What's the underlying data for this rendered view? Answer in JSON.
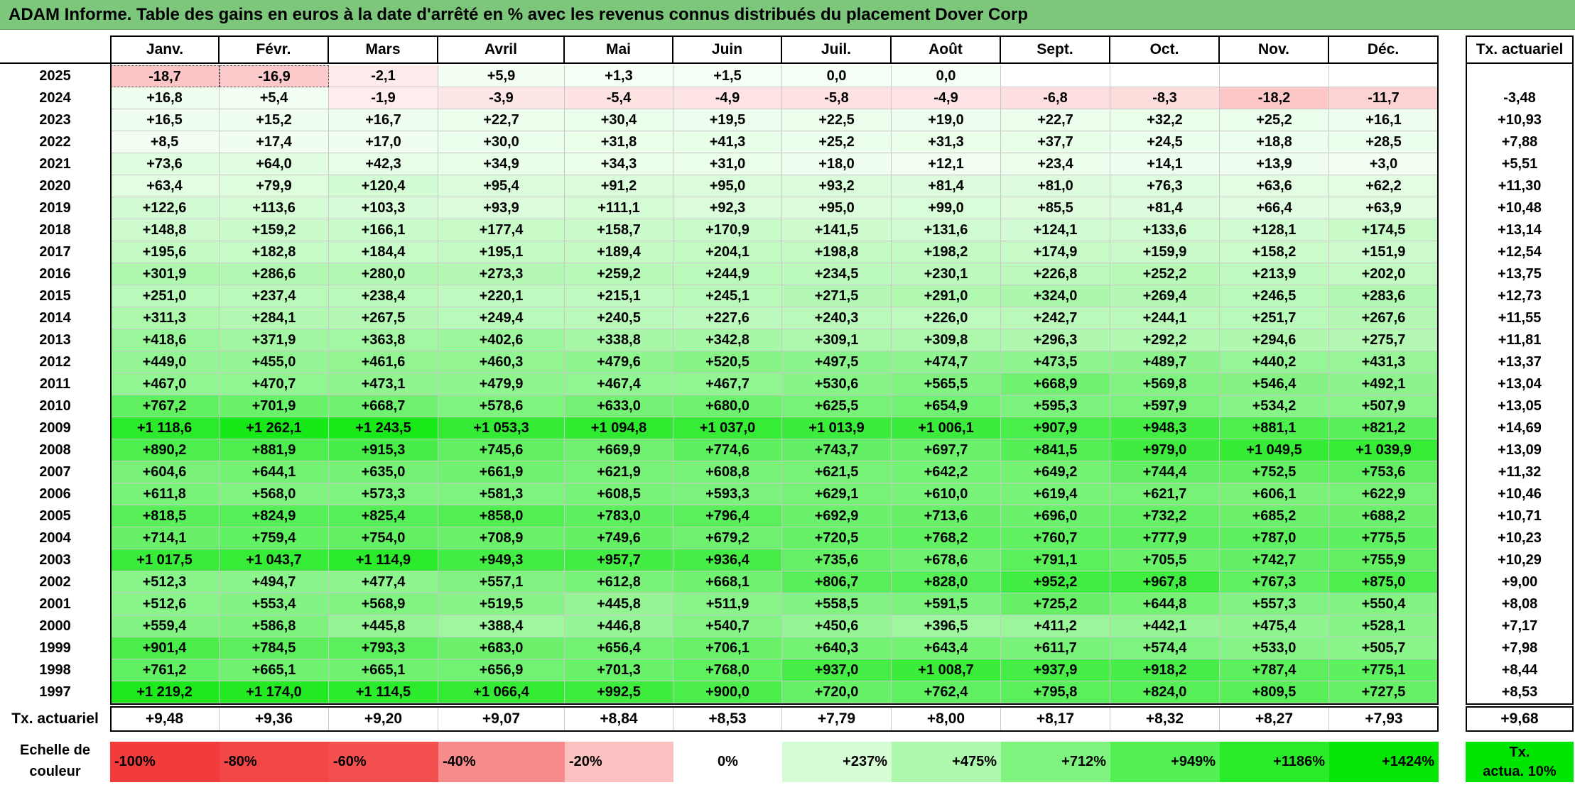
{
  "title": "ADAM Informe. Table des gains en euros à la date d'arrêté en % avec les revenus connus distribués du placement Dover Corp",
  "months": [
    "Janv.",
    "Févr.",
    "Mars",
    "Avril",
    "Mai",
    "Juin",
    "Juil.",
    "Août",
    "Sept.",
    "Oct.",
    "Nov.",
    "Déc."
  ],
  "rate_header": "Tx. actuariel",
  "rows": [
    {
      "year": "2025",
      "values": [
        "-18,7",
        "-16,9",
        "-2,1",
        "+5,9",
        "+1,3",
        "+1,5",
        "0,0",
        "0,0",
        "",
        "",
        "",
        ""
      ],
      "rate": ""
    },
    {
      "year": "2024",
      "values": [
        "+16,8",
        "+5,4",
        "-1,9",
        "-3,9",
        "-5,4",
        "-4,9",
        "-5,8",
        "-4,9",
        "-6,8",
        "-8,3",
        "-18,2",
        "-11,7"
      ],
      "rate": "-3,48"
    },
    {
      "year": "2023",
      "values": [
        "+16,5",
        "+15,2",
        "+16,7",
        "+22,7",
        "+30,4",
        "+19,5",
        "+22,5",
        "+19,0",
        "+22,7",
        "+32,2",
        "+25,2",
        "+16,1"
      ],
      "rate": "+10,93"
    },
    {
      "year": "2022",
      "values": [
        "+8,5",
        "+17,4",
        "+17,0",
        "+30,0",
        "+31,8",
        "+41,3",
        "+25,2",
        "+31,3",
        "+37,7",
        "+24,5",
        "+18,8",
        "+28,5"
      ],
      "rate": "+7,88"
    },
    {
      "year": "2021",
      "values": [
        "+73,6",
        "+64,0",
        "+42,3",
        "+34,9",
        "+34,3",
        "+31,0",
        "+18,0",
        "+12,1",
        "+23,4",
        "+14,1",
        "+13,9",
        "+3,0"
      ],
      "rate": "+5,51"
    },
    {
      "year": "2020",
      "values": [
        "+63,4",
        "+79,9",
        "+120,4",
        "+95,4",
        "+91,2",
        "+95,0",
        "+93,2",
        "+81,4",
        "+81,0",
        "+76,3",
        "+63,6",
        "+62,2"
      ],
      "rate": "+11,30"
    },
    {
      "year": "2019",
      "values": [
        "+122,6",
        "+113,6",
        "+103,3",
        "+93,9",
        "+111,1",
        "+92,3",
        "+95,0",
        "+99,0",
        "+85,5",
        "+81,4",
        "+66,4",
        "+63,9"
      ],
      "rate": "+10,48"
    },
    {
      "year": "2018",
      "values": [
        "+148,8",
        "+159,2",
        "+166,1",
        "+177,4",
        "+158,7",
        "+170,9",
        "+141,5",
        "+131,6",
        "+124,1",
        "+133,6",
        "+128,1",
        "+174,5"
      ],
      "rate": "+13,14"
    },
    {
      "year": "2017",
      "values": [
        "+195,6",
        "+182,8",
        "+184,4",
        "+195,1",
        "+189,4",
        "+204,1",
        "+198,8",
        "+198,2",
        "+174,9",
        "+159,9",
        "+158,2",
        "+151,9"
      ],
      "rate": "+12,54"
    },
    {
      "year": "2016",
      "values": [
        "+301,9",
        "+286,6",
        "+280,0",
        "+273,3",
        "+259,2",
        "+244,9",
        "+234,5",
        "+230,1",
        "+226,8",
        "+252,2",
        "+213,9",
        "+202,0"
      ],
      "rate": "+13,75"
    },
    {
      "year": "2015",
      "values": [
        "+251,0",
        "+237,4",
        "+238,4",
        "+220,1",
        "+215,1",
        "+245,1",
        "+271,5",
        "+291,0",
        "+324,0",
        "+269,4",
        "+246,5",
        "+283,6"
      ],
      "rate": "+12,73"
    },
    {
      "year": "2014",
      "values": [
        "+311,3",
        "+284,1",
        "+267,5",
        "+249,4",
        "+240,5",
        "+227,6",
        "+240,3",
        "+226,0",
        "+242,7",
        "+244,1",
        "+251,7",
        "+267,6"
      ],
      "rate": "+11,55"
    },
    {
      "year": "2013",
      "values": [
        "+418,6",
        "+371,9",
        "+363,8",
        "+402,6",
        "+338,8",
        "+342,8",
        "+309,1",
        "+309,8",
        "+296,3",
        "+292,2",
        "+294,6",
        "+275,7"
      ],
      "rate": "+11,81"
    },
    {
      "year": "2012",
      "values": [
        "+449,0",
        "+455,0",
        "+461,6",
        "+460,3",
        "+479,6",
        "+520,5",
        "+497,5",
        "+474,7",
        "+473,5",
        "+489,7",
        "+440,2",
        "+431,3"
      ],
      "rate": "+13,37"
    },
    {
      "year": "2011",
      "values": [
        "+467,0",
        "+470,7",
        "+473,1",
        "+479,9",
        "+467,4",
        "+467,7",
        "+530,6",
        "+565,5",
        "+668,9",
        "+569,8",
        "+546,4",
        "+492,1"
      ],
      "rate": "+13,04"
    },
    {
      "year": "2010",
      "values": [
        "+767,2",
        "+701,9",
        "+668,7",
        "+578,6",
        "+633,0",
        "+680,0",
        "+625,5",
        "+654,9",
        "+595,3",
        "+597,9",
        "+534,2",
        "+507,9"
      ],
      "rate": "+13,05"
    },
    {
      "year": "2009",
      "values": [
        "+1 118,6",
        "+1 262,1",
        "+1 243,5",
        "+1 053,3",
        "+1 094,8",
        "+1 037,0",
        "+1 013,9",
        "+1 006,1",
        "+907,9",
        "+948,3",
        "+881,1",
        "+821,2"
      ],
      "rate": "+14,69"
    },
    {
      "year": "2008",
      "values": [
        "+890,2",
        "+881,9",
        "+915,3",
        "+745,6",
        "+669,9",
        "+774,6",
        "+743,7",
        "+697,7",
        "+841,5",
        "+979,0",
        "+1 049,5",
        "+1 039,9"
      ],
      "rate": "+13,09"
    },
    {
      "year": "2007",
      "values": [
        "+604,6",
        "+644,1",
        "+635,0",
        "+661,9",
        "+621,9",
        "+608,8",
        "+621,5",
        "+642,2",
        "+649,2",
        "+744,4",
        "+752,5",
        "+753,6"
      ],
      "rate": "+11,32"
    },
    {
      "year": "2006",
      "values": [
        "+611,8",
        "+568,0",
        "+573,3",
        "+581,3",
        "+608,5",
        "+593,3",
        "+629,1",
        "+610,0",
        "+619,4",
        "+621,7",
        "+606,1",
        "+622,9"
      ],
      "rate": "+10,46"
    },
    {
      "year": "2005",
      "values": [
        "+818,5",
        "+824,9",
        "+825,4",
        "+858,0",
        "+783,0",
        "+796,4",
        "+692,9",
        "+713,6",
        "+696,0",
        "+732,2",
        "+685,2",
        "+688,2"
      ],
      "rate": "+10,71"
    },
    {
      "year": "2004",
      "values": [
        "+714,1",
        "+759,4",
        "+754,0",
        "+708,9",
        "+749,6",
        "+679,2",
        "+720,5",
        "+768,2",
        "+760,7",
        "+777,9",
        "+787,0",
        "+775,5"
      ],
      "rate": "+10,23"
    },
    {
      "year": "2003",
      "values": [
        "+1 017,5",
        "+1 043,7",
        "+1 114,9",
        "+949,3",
        "+957,7",
        "+936,4",
        "+735,6",
        "+678,6",
        "+791,1",
        "+705,5",
        "+742,7",
        "+755,9"
      ],
      "rate": "+10,29"
    },
    {
      "year": "2002",
      "values": [
        "+512,3",
        "+494,7",
        "+477,4",
        "+557,1",
        "+612,8",
        "+668,1",
        "+806,7",
        "+828,0",
        "+952,2",
        "+967,8",
        "+767,3",
        "+875,0"
      ],
      "rate": "+9,00"
    },
    {
      "year": "2001",
      "values": [
        "+512,6",
        "+553,4",
        "+568,9",
        "+519,5",
        "+445,8",
        "+511,9",
        "+558,5",
        "+591,5",
        "+725,2",
        "+644,8",
        "+557,3",
        "+550,4"
      ],
      "rate": "+8,08"
    },
    {
      "year": "2000",
      "values": [
        "+559,4",
        "+586,8",
        "+445,8",
        "+388,4",
        "+446,8",
        "+540,7",
        "+450,6",
        "+396,5",
        "+411,2",
        "+442,1",
        "+475,4",
        "+528,1"
      ],
      "rate": "+7,17"
    },
    {
      "year": "1999",
      "values": [
        "+901,4",
        "+784,5",
        "+793,3",
        "+683,0",
        "+656,4",
        "+706,1",
        "+640,3",
        "+643,4",
        "+611,7",
        "+574,4",
        "+533,0",
        "+505,7"
      ],
      "rate": "+7,98"
    },
    {
      "year": "1998",
      "values": [
        "+761,2",
        "+665,1",
        "+665,1",
        "+656,9",
        "+701,3",
        "+768,0",
        "+937,0",
        "+1 008,7",
        "+937,9",
        "+918,2",
        "+787,4",
        "+775,1"
      ],
      "rate": "+8,44"
    },
    {
      "year": "1997",
      "values": [
        "+1 219,2",
        "+1 174,0",
        "+1 114,5",
        "+1 066,4",
        "+992,5",
        "+900,0",
        "+720,0",
        "+762,4",
        "+795,8",
        "+824,0",
        "+809,5",
        "+727,5"
      ],
      "rate": "+8,53"
    }
  ],
  "footer": {
    "label": "Tx. actuariel",
    "values": [
      "+9,48",
      "+9,36",
      "+9,20",
      "+9,07",
      "+8,84",
      "+8,53",
      "+7,79",
      "+8,00",
      "+8,17",
      "+8,32",
      "+8,27",
      "+7,93"
    ],
    "total": "+9,68"
  },
  "scale": {
    "label_line1": "Echelle de",
    "label_line2": "couleur",
    "items": [
      {
        "label": "-100%",
        "color": "#f23b3b"
      },
      {
        "label": "-80%",
        "color": "#f34646"
      },
      {
        "label": "-60%",
        "color": "#f45050"
      },
      {
        "label": "-40%",
        "color": "#f78a8a"
      },
      {
        "label": "-20%",
        "color": "#fbc0c0"
      },
      {
        "label": "0%",
        "color": "#ffffff"
      },
      {
        "label": "+237%",
        "color": "#d6fcd6"
      },
      {
        "label": "+475%",
        "color": "#adf8ad"
      },
      {
        "label": "+712%",
        "color": "#7ef47e"
      },
      {
        "label": "+949%",
        "color": "#52f052"
      },
      {
        "label": "+1186%",
        "color": "#2aeb2a"
      },
      {
        "label": "+1424%",
        "color": "#05e605"
      }
    ],
    "actuarial_line1": "Tx.",
    "actuarial_line2": "actua. 10%",
    "actuarial_color": "#00e600"
  }
}
